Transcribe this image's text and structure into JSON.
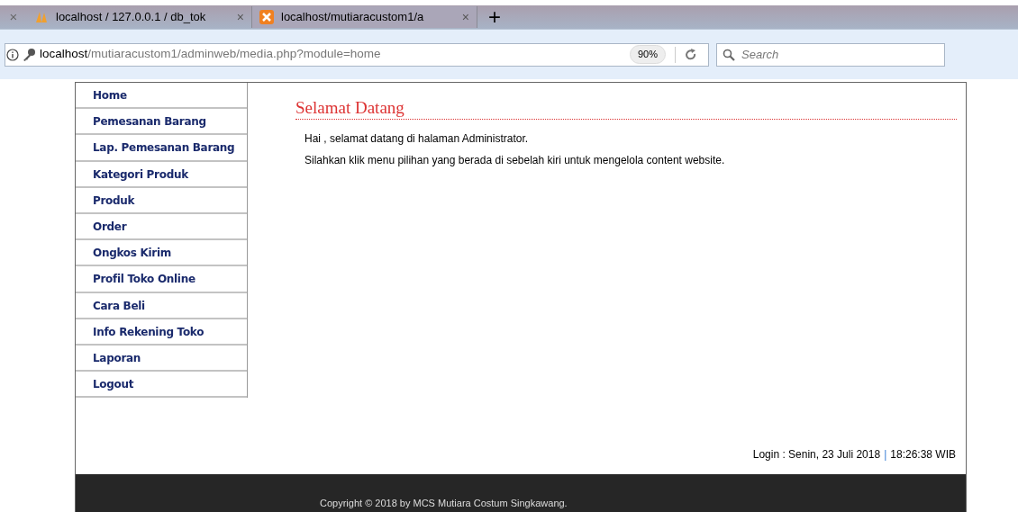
{
  "browser": {
    "closed_tab_mark": "×",
    "tabs": [
      {
        "label": "localhost / 127.0.0.1 / db_tok",
        "close": "×",
        "selected": false
      },
      {
        "label": "localhost/mutiaracustom1/a",
        "close": "×",
        "selected": true
      }
    ],
    "new_tab": "+",
    "address": {
      "host": "localhost",
      "path": "/mutiaracustom1/adminweb/media.php?module=home",
      "zoom": "90%"
    },
    "search": {
      "placeholder": "Search"
    }
  },
  "sidebar": {
    "items": [
      {
        "label": "Home"
      },
      {
        "label": "Pemesanan Barang"
      },
      {
        "label": "Lap. Pemesanan Barang"
      },
      {
        "label": "Kategori Produk"
      },
      {
        "label": "Produk"
      },
      {
        "label": "Order"
      },
      {
        "label": "Ongkos Kirim"
      },
      {
        "label": "Profil Toko Online"
      },
      {
        "label": "Cara Beli"
      },
      {
        "label": "Info Rekening Toko"
      },
      {
        "label": "Laporan"
      },
      {
        "label": "Logout"
      }
    ]
  },
  "content": {
    "title": "Selamat Datang",
    "paragraphs": [
      "Hai , selamat datang di halaman Administrator.",
      "Silahkan klik menu pilihan yang berada di sebelah kiri untuk mengelola content website."
    ]
  },
  "login": {
    "label": "Login : Senin, 23 Juli 2018",
    "separator": "|",
    "time": "18:26:38 WIB"
  },
  "footer": {
    "copyright": "Copyright © 2018 by MCS Mutiara Costum Singkawang."
  }
}
